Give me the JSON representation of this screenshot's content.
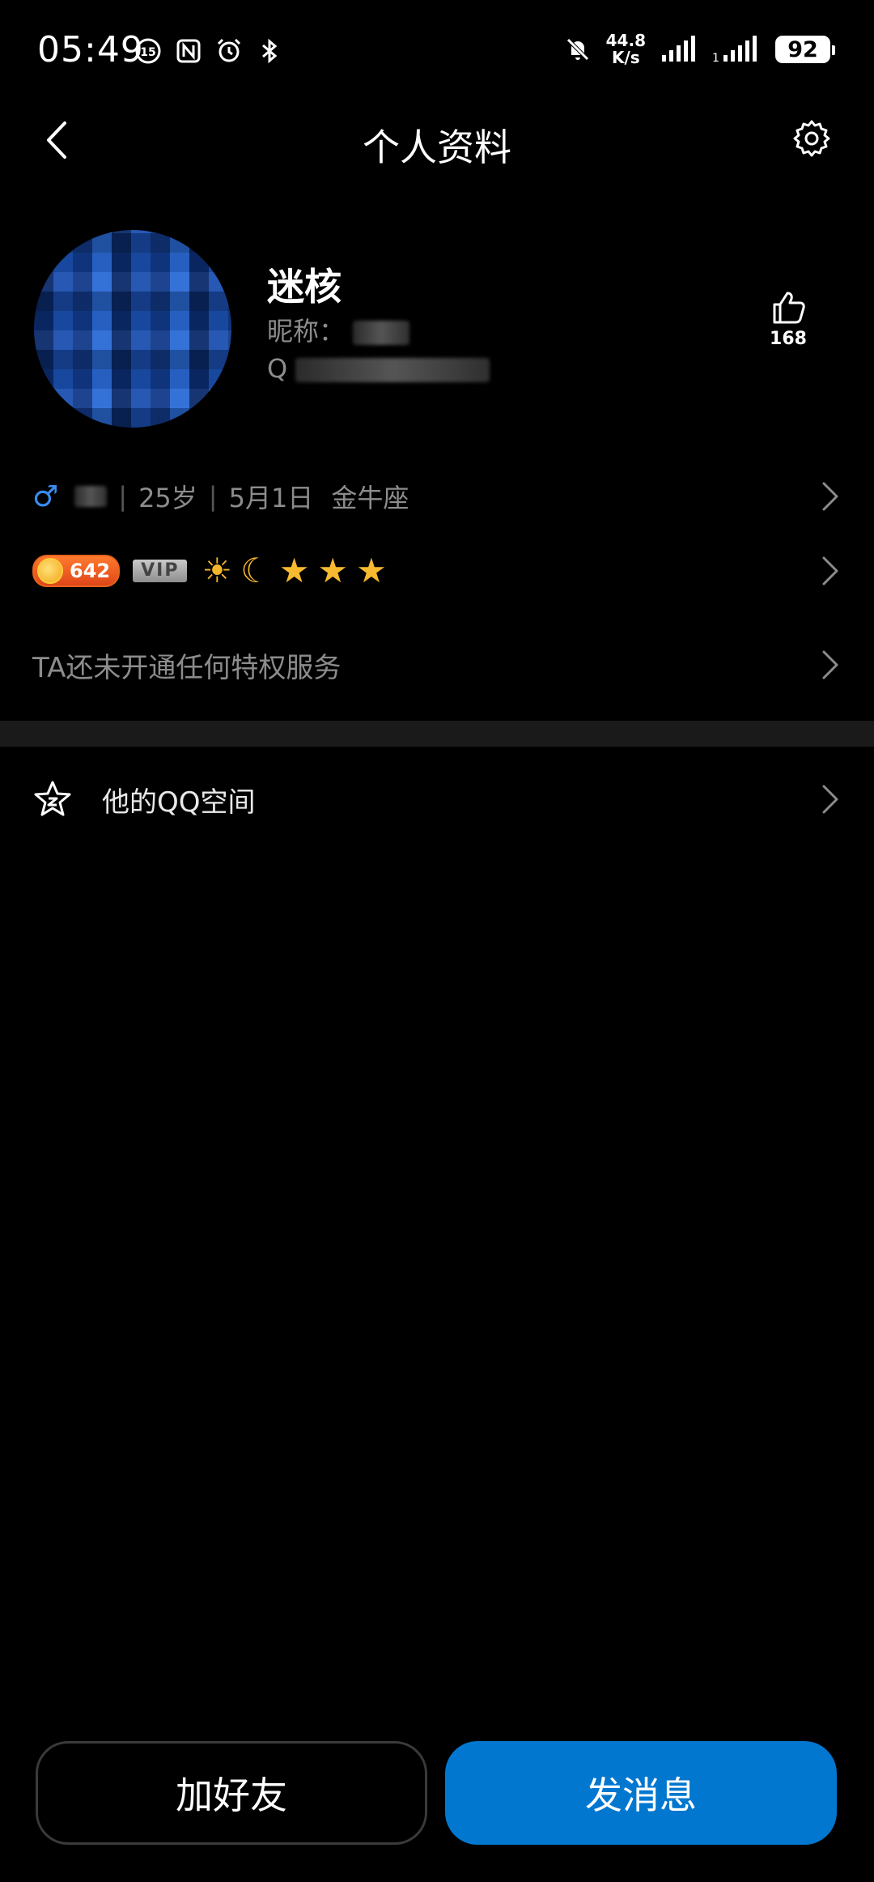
{
  "status_bar": {
    "time": "05:49",
    "net_speed_value": "44.8",
    "net_speed_unit": "K/s",
    "battery": "92"
  },
  "header": {
    "title": "个人资料"
  },
  "profile": {
    "name": "迷核",
    "nickname_label": "昵称：",
    "qq_prefix": "Q",
    "likes": "168"
  },
  "info": {
    "age": "25岁",
    "birthday": "5月1日",
    "zodiac": "金牛座",
    "level": "642",
    "vip_label": "VIP",
    "privilege_text": "TA还未开通任何特权服务",
    "qzone_label": "他的QQ空间"
  },
  "actions": {
    "add_friend": "加好友",
    "send_message": "发消息"
  },
  "colors": {
    "accent": "#0277cf",
    "gender_male": "#3b8cf0",
    "level_badge": "#e8641b",
    "star": "#f6b92f"
  }
}
